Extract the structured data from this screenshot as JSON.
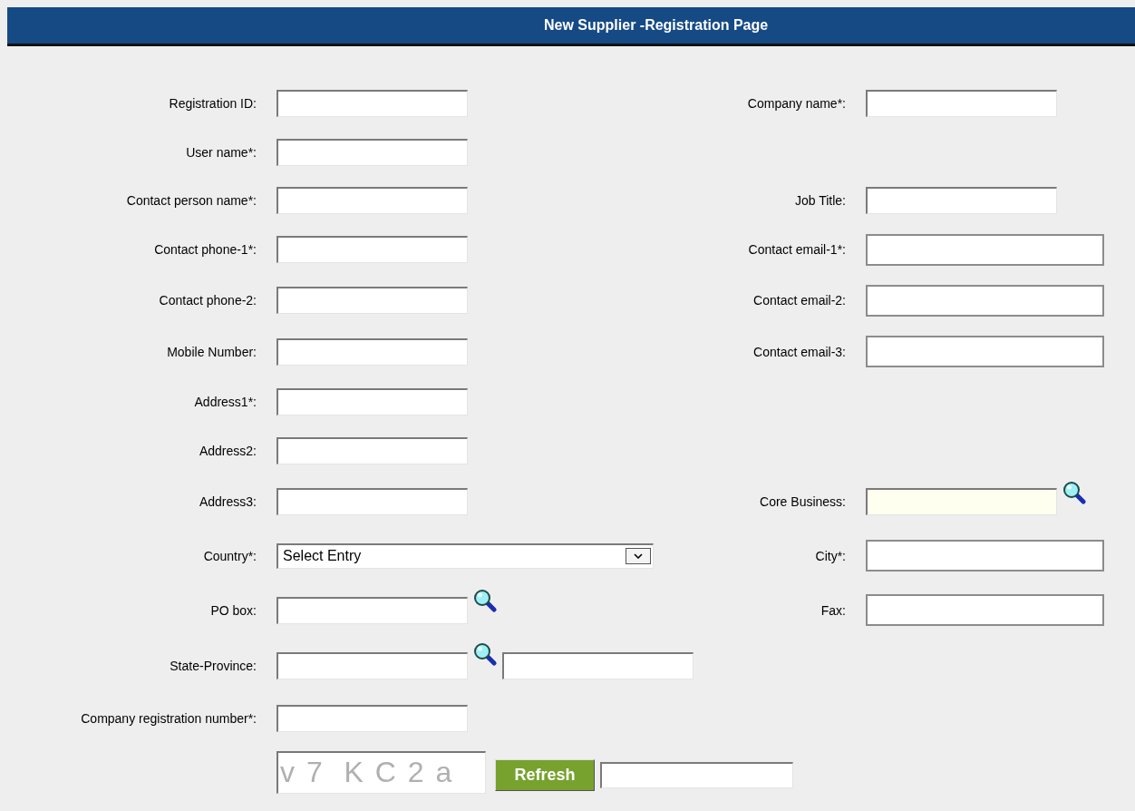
{
  "header": {
    "title": "New Supplier -Registration Page"
  },
  "rows": [
    {
      "left": {
        "label": "Registration ID:",
        "kind": "text"
      },
      "right": {
        "label": "Company name*:",
        "kind": "text"
      }
    },
    {
      "left": {
        "label": "User name*:",
        "kind": "text"
      }
    },
    {
      "left": {
        "label": "Contact person name*:",
        "kind": "text"
      },
      "right": {
        "label": "Job Title:",
        "kind": "text"
      }
    },
    {
      "left": {
        "label": "Contact phone-1*:",
        "kind": "text"
      },
      "right": {
        "label": "Contact email-1*:",
        "kind": "wide"
      }
    },
    {
      "left": {
        "label": "Contact phone-2:",
        "kind": "text"
      },
      "right": {
        "label": "Contact email-2:",
        "kind": "wide"
      }
    },
    {
      "left": {
        "label": "Mobile Number:",
        "kind": "text"
      },
      "right": {
        "label": "Contact email-3:",
        "kind": "wide"
      }
    },
    {
      "left": {
        "label": "Address1*:",
        "kind": "text"
      }
    },
    {
      "left": {
        "label": "Address2:",
        "kind": "text"
      }
    },
    {
      "left": {
        "label": "Address3:",
        "kind": "text"
      },
      "right": {
        "label": "Core Business:",
        "kind": "readonly_lookup"
      }
    },
    {
      "left": {
        "label": "Country*:",
        "kind": "select",
        "value": "Select Entry"
      },
      "right": {
        "label": "City*:",
        "kind": "wide"
      }
    },
    {
      "left": {
        "label": "PO box:",
        "kind": "lookup"
      },
      "right": {
        "label": "Fax:",
        "kind": "wide"
      }
    },
    {
      "left": {
        "label": "State-Province:",
        "kind": "lookup_pair"
      }
    },
    {
      "left": {
        "label": "Company registration number*:",
        "kind": "text"
      }
    }
  ],
  "captcha": {
    "code": "v 7  K C 2 a",
    "button": "Refresh"
  }
}
